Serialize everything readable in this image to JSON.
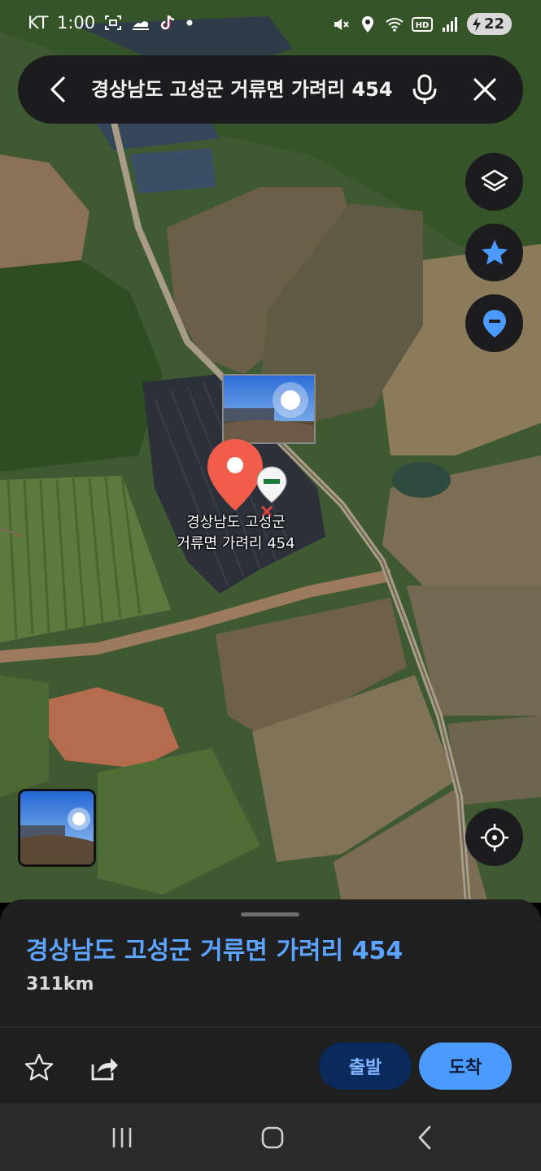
{
  "status_bar": {
    "carrier": "KT",
    "time": "1:00",
    "battery_level": "22",
    "icons_left": [
      "screenshot-icon",
      "weather-icon",
      "tiktok-icon",
      "dot-icon"
    ],
    "icons_right": [
      "mute-icon",
      "location-icon",
      "wifi-icon",
      "hd-icon",
      "signal-icon",
      "battery-charging-icon"
    ]
  },
  "search": {
    "query": "경상남도 고성군 거류면 가려리 454",
    "icons": [
      "back-icon",
      "mic-icon",
      "close-icon"
    ]
  },
  "map_controls": [
    "layers-icon",
    "star-icon",
    "pin-icon",
    "my-location-icon"
  ],
  "marker": {
    "label_line1": "경상남도 고성군",
    "label_line2": "거류면 가려리 454",
    "pin_color": "#f25c4a"
  },
  "place": {
    "title": "경상남도 고성군 거류면 가려리 454",
    "distance": "311km"
  },
  "actions": {
    "depart_label": "출발",
    "arrive_label": "도착",
    "icons": [
      "star-outline-icon",
      "share-icon"
    ]
  },
  "nav_bar": {
    "icons": [
      "recents-icon",
      "home-icon",
      "back-nav-icon"
    ]
  },
  "colors": {
    "accent": "#4b9bff",
    "title_blue": "#5ba4ff",
    "depart_bg": "#0b2a5c",
    "sheet_bg": "#1f1f1f"
  }
}
